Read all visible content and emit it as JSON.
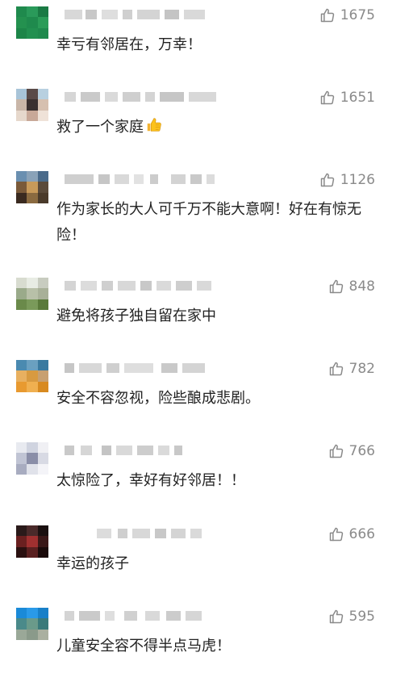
{
  "comments": [
    {
      "likes": "1675",
      "text": "幸亏有邻居在，万幸！",
      "avatar_colors": [
        "#1f8a4d",
        "#2a9a5a",
        "#1a7a44",
        "#24914f",
        "#1f8a4d",
        "#2b9c58",
        "#1d8548",
        "#229050",
        "#1f8a4d"
      ]
    },
    {
      "likes": "1651",
      "text": "救了一个家庭",
      "emoji": "thumbs-up-emoji",
      "avatar_colors": [
        "#a8c4d8",
        "#5a4a48",
        "#b8d0e0",
        "#c9b6a8",
        "#3a3030",
        "#d6c0b0",
        "#e6d8cc",
        "#c8a898",
        "#efe2d8"
      ]
    },
    {
      "likes": "1126",
      "text": "作为家长的大人可千万不能大意啊！好在有惊无险！",
      "avatar_colors": [
        "#6a8fb0",
        "#8aa2b8",
        "#4a6a8a",
        "#7a5a3a",
        "#c89a5a",
        "#5a4a3a",
        "#3a2a20",
        "#8a6a40",
        "#4a3a2a"
      ]
    },
    {
      "likes": "848",
      "text": "避免将孩子独自留在家中",
      "avatar_colors": [
        "#d8dcd0",
        "#e8ece4",
        "#c8ccc0",
        "#9aaa8a",
        "#b8c0a8",
        "#a8b098",
        "#6a8a4a",
        "#7a9a5a",
        "#5a7a3a"
      ]
    },
    {
      "likes": "782",
      "text": "安全不容忽视，险些酿成悲剧。",
      "avatar_colors": [
        "#4a8ab0",
        "#6aa0c0",
        "#3a7aa0",
        "#e8b060",
        "#d89a40",
        "#c8a070",
        "#e89a30",
        "#f0b050",
        "#d88a20"
      ]
    },
    {
      "likes": "766",
      "text": "太惊险了，幸好有好邻居！！",
      "avatar_colors": [
        "#e8eaf0",
        "#d0d4e0",
        "#f0f0f4",
        "#c0c4d4",
        "#8a8ea8",
        "#d8dae4",
        "#a8acc0",
        "#e0e2ea",
        "#f4f4f8"
      ]
    },
    {
      "likes": "666",
      "text": "幸运的孩子",
      "avatar_colors": [
        "#2a1a1a",
        "#4a2a2a",
        "#1a1010",
        "#6a2020",
        "#a03030",
        "#3a1818",
        "#2a1010",
        "#5a2020",
        "#1a0a0a"
      ]
    },
    {
      "likes": "595",
      "text": "儿童安全容不得半点马虎！",
      "avatar_colors": [
        "#1a8ad8",
        "#2a9ae8",
        "#1880c8",
        "#4a8a8a",
        "#6a9a8a",
        "#3a7a7a",
        "#9aa898",
        "#8a9a8a",
        "#aab0a0"
      ]
    }
  ]
}
